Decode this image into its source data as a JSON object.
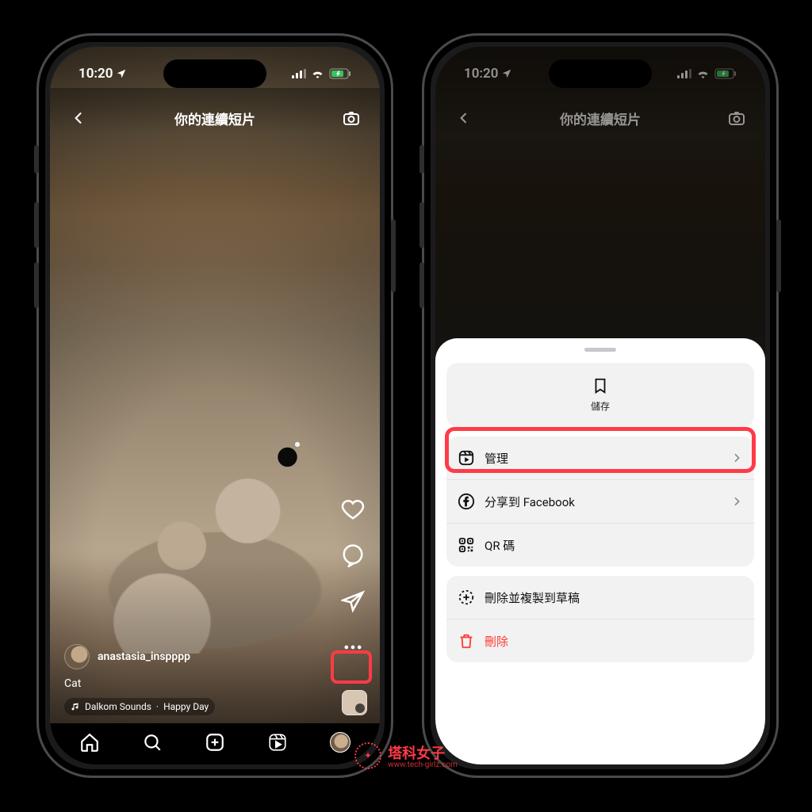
{
  "status": {
    "time": "10:20"
  },
  "header": {
    "title": "你的連續短片"
  },
  "reel": {
    "username": "anastasia_inspppp",
    "caption": "Cat",
    "music_artist": "Dalkom Sounds",
    "music_title": "Happy Day"
  },
  "sheet": {
    "save": "儲存",
    "manage": "管理",
    "share_fb": "分享到 Facebook",
    "qr": "QR 碼",
    "draft": "刪除並複製到草稿",
    "delete": "刪除"
  },
  "watermark": {
    "brand": "塔科女子",
    "site": "www.tech-girlz.com"
  }
}
